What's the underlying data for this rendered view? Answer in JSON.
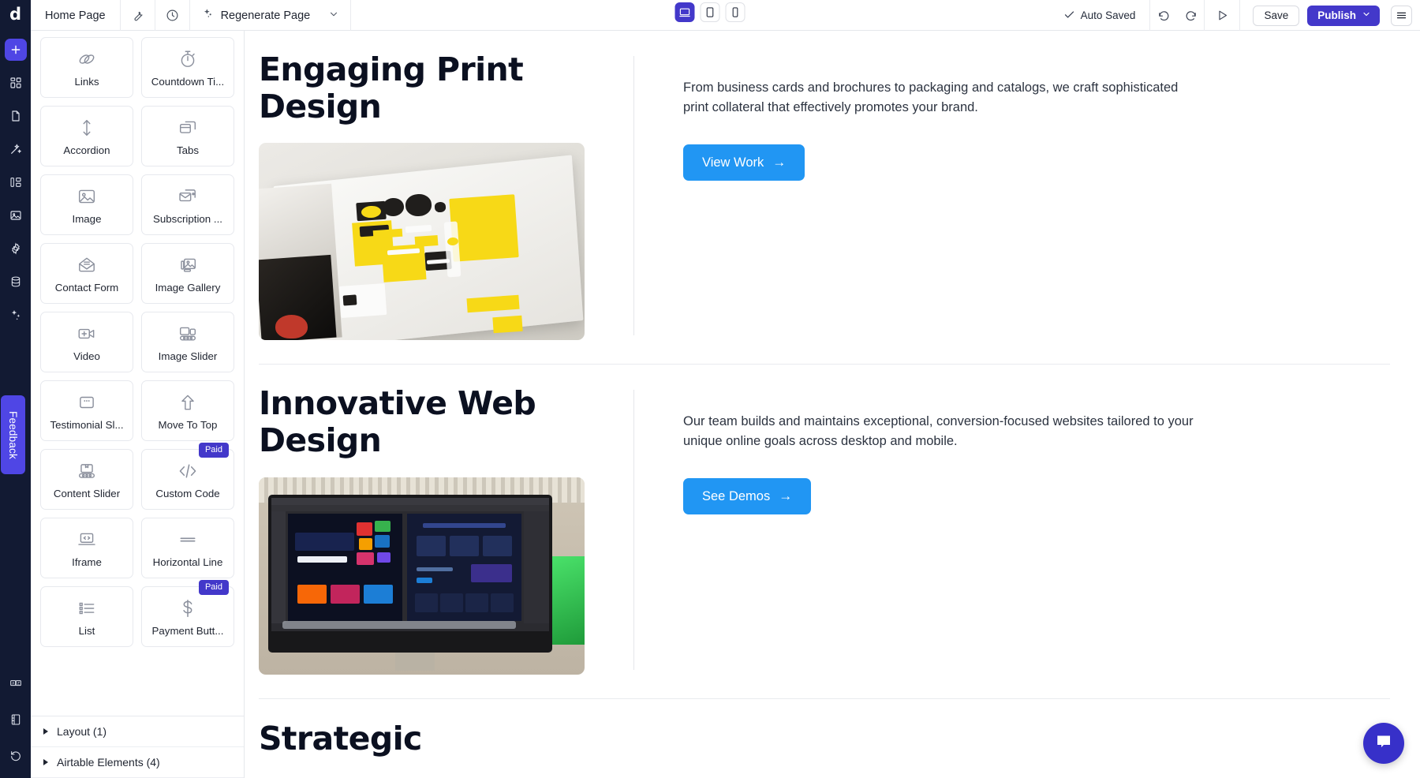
{
  "topbar": {
    "brand_glyph": "d",
    "page_name": "Home Page",
    "wrench_icon": "wrench-icon",
    "history_icon": "clock-history-icon",
    "regenerate_label": "Regenerate Page",
    "sparkle_icon": "sparkle-icon",
    "chevron_icon": "chevron-down-icon",
    "devices": [
      {
        "name": "desktop",
        "icon": "desktop-icon",
        "active": true
      },
      {
        "name": "tablet",
        "icon": "tablet-icon",
        "active": false
      },
      {
        "name": "mobile",
        "icon": "mobile-icon",
        "active": false
      }
    ],
    "autosaved_label": "Auto Saved",
    "check_icon": "check-icon",
    "undo_icon": "undo-icon",
    "redo_icon": "redo-icon",
    "preview_icon": "play-preview-icon",
    "save_label": "Save",
    "publish_label": "Publish",
    "menu_icon": "hamburger-menu-icon",
    "accent_color": "#4338ca"
  },
  "rail": {
    "items": [
      {
        "name": "add",
        "icon": "plus-icon",
        "active": true
      },
      {
        "name": "sections",
        "icon": "grid-blocks-icon",
        "active": false
      },
      {
        "name": "pages",
        "icon": "page-icon",
        "active": false
      },
      {
        "name": "theme",
        "icon": "magic-wand-icon",
        "active": false
      },
      {
        "name": "structure",
        "icon": "sitemap-icon",
        "active": false
      },
      {
        "name": "media",
        "icon": "image-icon",
        "active": false
      },
      {
        "name": "settings",
        "icon": "gear-icon",
        "active": false
      },
      {
        "name": "database",
        "icon": "database-icon",
        "active": false
      },
      {
        "name": "ai",
        "icon": "sparkles-icon",
        "active": false
      }
    ],
    "feedback_label": "Feedback",
    "bottom_items": [
      {
        "name": "translate",
        "icon": "translate-icon"
      },
      {
        "name": "notes",
        "icon": "notebook-icon"
      },
      {
        "name": "restore",
        "icon": "restore-history-icon"
      }
    ],
    "background": "#121a33",
    "accent": "#4f46e5"
  },
  "panel": {
    "widgets": [
      {
        "label": "Links",
        "icon": "link-chain-icon",
        "paid": false
      },
      {
        "label": "Countdown Ti...",
        "icon": "stopwatch-icon",
        "paid": false
      },
      {
        "label": "Accordion",
        "icon": "vertical-arrows-icon",
        "paid": false
      },
      {
        "label": "Tabs",
        "icon": "tabs-icon",
        "paid": false
      },
      {
        "label": "Image",
        "icon": "image-icon",
        "paid": false
      },
      {
        "label": "Subscription ...",
        "icon": "envelope-card-icon",
        "paid": false
      },
      {
        "label": "Contact Form",
        "icon": "open-envelope-icon",
        "paid": false
      },
      {
        "label": "Image Gallery",
        "icon": "image-gallery-icon",
        "paid": false
      },
      {
        "label": "Video",
        "icon": "video-camera-icon",
        "paid": false
      },
      {
        "label": "Image Slider",
        "icon": "image-slider-icon",
        "paid": false
      },
      {
        "label": "Testimonial Sl...",
        "icon": "testimonial-card-icon",
        "paid": false
      },
      {
        "label": "Move To Top",
        "icon": "arrow-up-icon",
        "paid": false
      },
      {
        "label": "Content Slider",
        "icon": "content-slider-icon",
        "paid": false
      },
      {
        "label": "Custom Code",
        "icon": "code-slash-icon",
        "paid": true
      },
      {
        "label": "Iframe",
        "icon": "laptop-code-icon",
        "paid": false
      },
      {
        "label": "Horizontal Line",
        "icon": "horizontal-line-icon",
        "paid": false
      },
      {
        "label": "List",
        "icon": "bullet-list-icon",
        "paid": false
      },
      {
        "label": "Payment Butt...",
        "icon": "dollar-sign-icon",
        "paid": true
      }
    ],
    "paid_badge_label": "Paid",
    "sections": [
      {
        "label": "Layout (1)"
      },
      {
        "label": "Airtable Elements (4)"
      }
    ]
  },
  "canvas": {
    "sections": [
      {
        "title": "Engaging Print Design",
        "body": "From business cards and brochures to packaging and catalogs, we craft sophisticated print collateral that effectively promotes your brand.",
        "cta_label": "View Work",
        "cta_arrow": "→",
        "image_alt": "print-brochure-photo"
      },
      {
        "title": "Innovative Web Design",
        "body": "Our team builds and maintains exceptional, conversion-focused websites tailored to your unique online goals across desktop and mobile.",
        "cta_label": "See Demos",
        "cta_arrow": "→",
        "image_alt": "monitor-website-design-photo"
      }
    ],
    "next_section_title_partial": "Strategic",
    "cta_color": "#2196f3"
  },
  "chat": {
    "icon": "chat-bubble-icon",
    "color": "#3730c9"
  }
}
